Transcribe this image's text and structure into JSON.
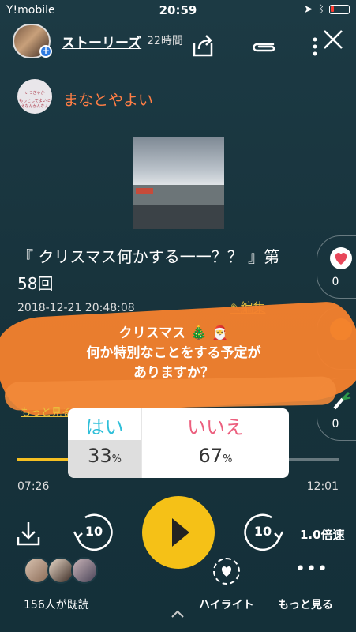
{
  "status_bar": {
    "carrier": "Y!mobile",
    "time": "20:59"
  },
  "header": {
    "stories_label": "ストーリーズ",
    "stories_time": "22時間"
  },
  "channel": {
    "name": "まなとやよい",
    "avatar_text_line1": "ぃつぎゃか",
    "avatar_text_line2": "もっとしてよいにえなんかんなぇ"
  },
  "episode": {
    "title": "『 クリスマス何かする一一？？ 』第58回",
    "datetime": "2018-12-21 20:48:08",
    "edit_label": "編集",
    "more_link": "もっと見る"
  },
  "reactions": [
    {
      "icon": "heart-icon",
      "count": "0",
      "color": "#e8475a"
    },
    {
      "icon": "laugh-icon",
      "count": "",
      "color": "#f5c117"
    },
    {
      "icon": "leek-icon",
      "count": "0",
      "color": "#2f9a4b"
    }
  ],
  "poll": {
    "question_line1": "クリスマス 🎄 🎅",
    "question_line2": "何か特別なことをする予定が",
    "question_line3": "ありますか？",
    "option_yes": "はい",
    "option_no": "いいえ",
    "yes_percent": "33",
    "no_percent": "67",
    "percent_unit": "%",
    "yes_color": "#2fbfd9",
    "no_color": "#ec5f7e"
  },
  "player": {
    "progress": 0.6,
    "elapsed": "07:26",
    "total": "12:01",
    "skip_back": "10",
    "skip_forward": "10",
    "speed": "1.0倍速"
  },
  "footer": {
    "readers_label": "156人が既読",
    "highlight_label": "ハイライト",
    "more_label": "もっと見る",
    "more_dots": "•••"
  },
  "colors": {
    "accent": "#f5c117",
    "channel_name": "#ff7e45",
    "background": "#1c3a44"
  }
}
